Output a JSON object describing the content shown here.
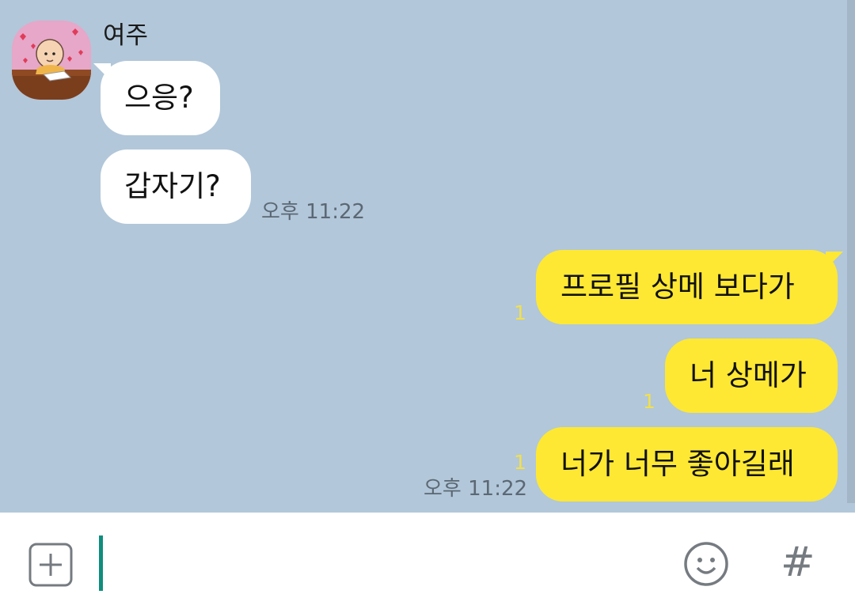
{
  "chat": {
    "sender_name": "여주",
    "incoming": [
      {
        "text": "으응?"
      },
      {
        "text": "갑자기?"
      }
    ],
    "incoming_time": "오후 11:22",
    "outgoing": [
      {
        "text": "프로필 상메 보다가",
        "unread": "1"
      },
      {
        "text": "너 상메가",
        "unread": "1"
      },
      {
        "text": "너가 너무 좋아길래",
        "unread": "1"
      }
    ],
    "outgoing_time": "오후 11:22"
  },
  "input_bar": {
    "icons": [
      "plus-square-icon",
      "emoji-icon",
      "hashtag-icon"
    ],
    "hashtag_label": "#"
  },
  "colors": {
    "chat_background": "#b2c7d9",
    "incoming_bubble": "#ffffff",
    "outgoing_bubble": "#fee833",
    "unread_count": "#f3e04a",
    "cursor": "#0f8e7d"
  }
}
